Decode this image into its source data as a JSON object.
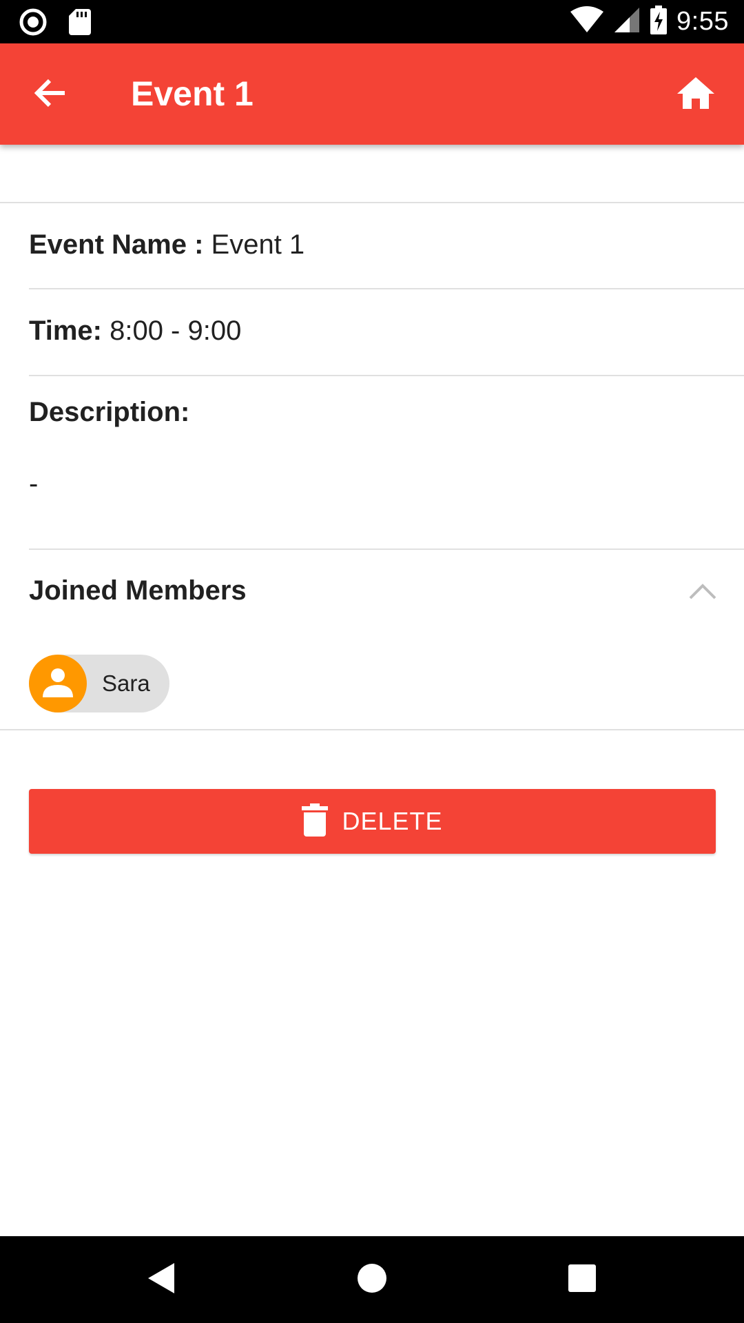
{
  "status_bar": {
    "time": "9:55",
    "icons": [
      "record-icon",
      "sd-card-icon",
      "wifi-icon",
      "cellular-signal-icon",
      "battery-charging-icon"
    ]
  },
  "app_bar": {
    "title": "Event 1",
    "back_icon": "arrow-back-icon",
    "home_icon": "home-icon",
    "color": "#f44336"
  },
  "details": {
    "event_name_label": "Event Name :",
    "event_name_value": " Event 1",
    "time_label": "Time:",
    "time_value": " 8:00 - 9:00",
    "description_label": "Description:",
    "description_value": "-"
  },
  "members": {
    "title": "Joined Members",
    "toggle_icon": "chevron-up-icon",
    "list": [
      {
        "name": "Sara",
        "avatar_icon": "person-icon",
        "avatar_color": "#ff9800"
      }
    ]
  },
  "actions": {
    "delete_label": "DELETE",
    "delete_icon": "trash-icon"
  },
  "nav_bar": {
    "icons": [
      "nav-back-icon",
      "nav-home-icon",
      "nav-recents-icon"
    ]
  }
}
